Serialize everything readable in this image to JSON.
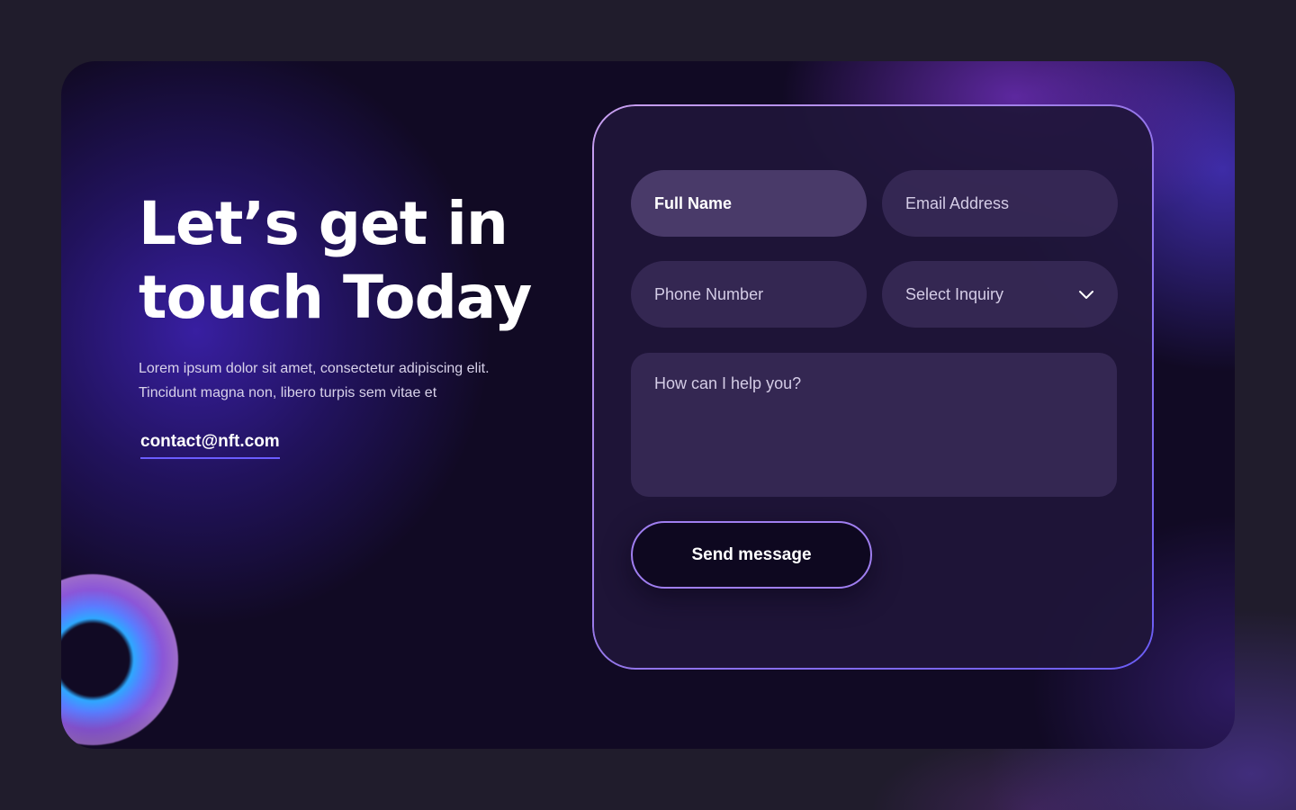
{
  "hero": {
    "headline_line1": "Let’s get in",
    "headline_line2": "touch Today",
    "intro_line1": "Lorem ipsum dolor sit amet, consectetur adipiscing elit.",
    "intro_line2": "Tincidunt magna non, libero turpis sem vitae et",
    "contact_email": "contact@nft.com"
  },
  "form": {
    "full_name": {
      "placeholder": "Full Name",
      "state": "focused"
    },
    "email": {
      "placeholder": "Email Address"
    },
    "phone": {
      "placeholder": "Phone Number"
    },
    "inquiry": {
      "selected": "Select Inquiry",
      "icon": "chevron-down-icon"
    },
    "message": {
      "placeholder": "How can I help you?"
    },
    "submit_label": "Send message"
  },
  "colors": {
    "background": "#201c2c",
    "card": "#110a24",
    "field": "#3c2e5c",
    "accent": "#6b5cff",
    "panel_border": "#9f7ef0"
  }
}
